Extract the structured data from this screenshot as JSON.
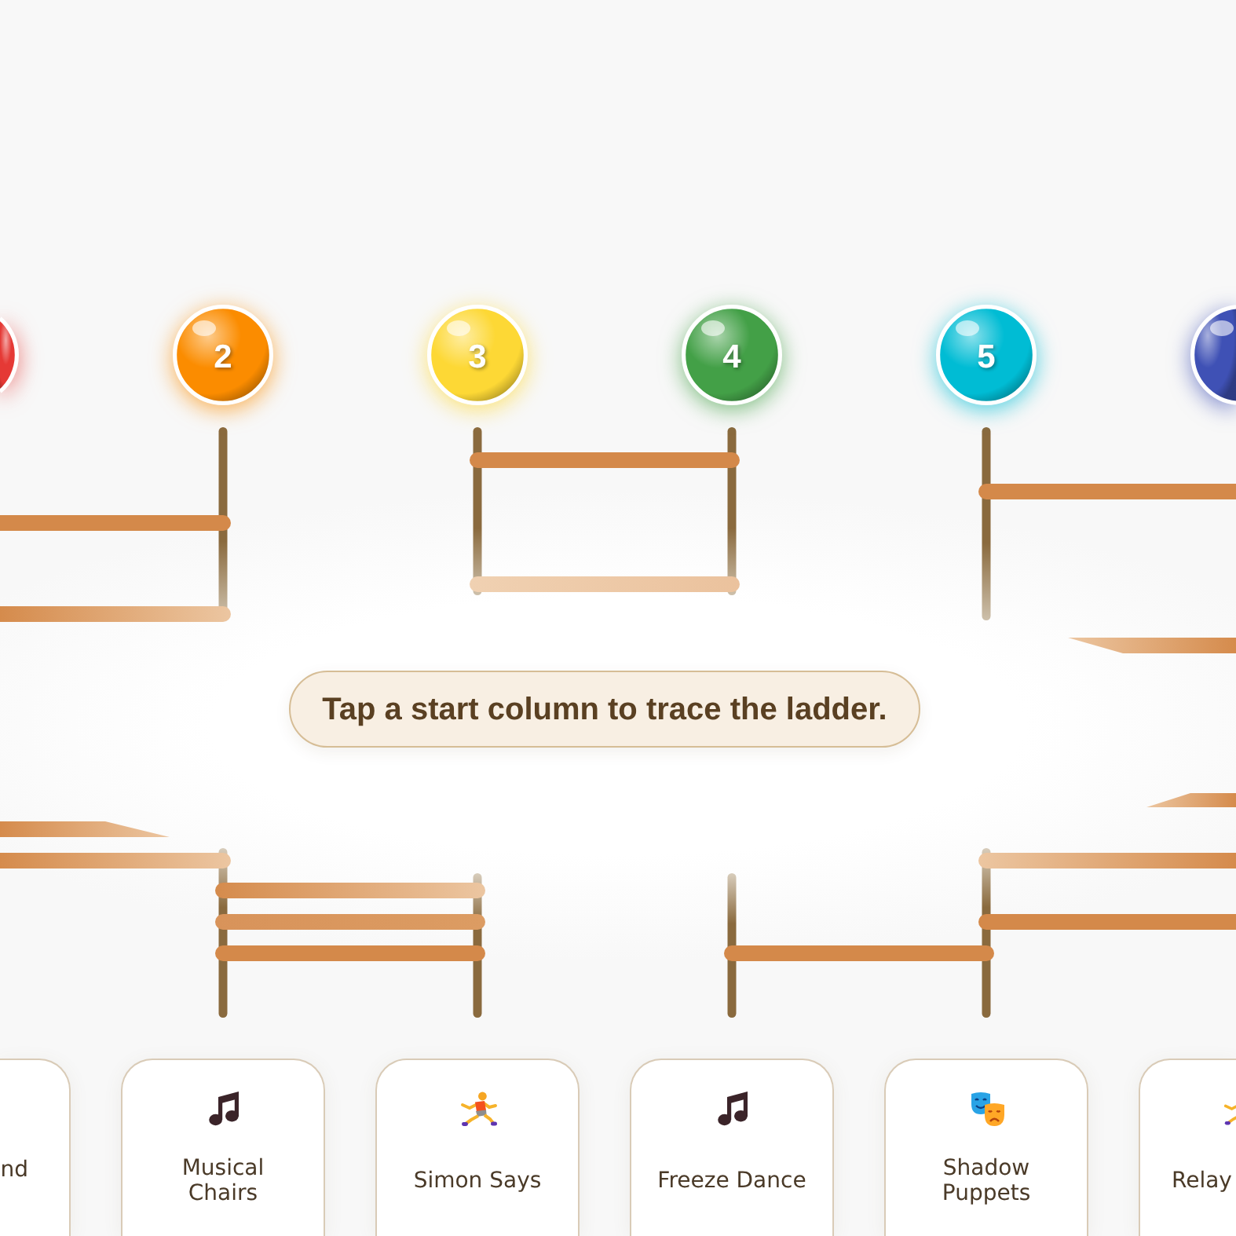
{
  "columns": [
    {
      "color": "#e53935"
    },
    {
      "label": "2",
      "color": "#fb8c00"
    },
    {
      "label": "3",
      "color": "#fdd835"
    },
    {
      "label": "4",
      "color": "#43a047"
    },
    {
      "label": "5",
      "color": "#00bcd4"
    },
    {
      "color": "#3f51b5"
    }
  ],
  "hint": "Tap a start column to trace the ladder.",
  "prizes": [
    {
      "label": "nd"
    },
    {
      "kind": "music",
      "label": "Musical Chairs"
    },
    {
      "kind": "runner",
      "label": "Simon Says"
    },
    {
      "kind": "music",
      "label": "Freeze Dance"
    },
    {
      "kind": "masks",
      "label": "Shadow Puppets"
    },
    {
      "kind": "runner",
      "label": "Relay"
    }
  ]
}
